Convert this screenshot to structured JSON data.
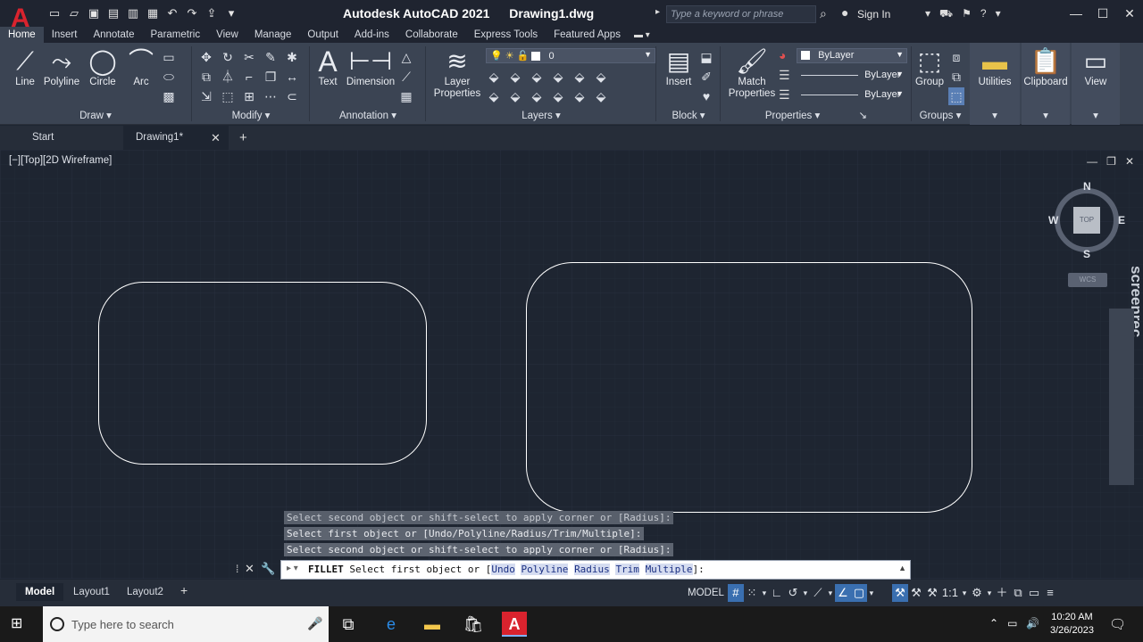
{
  "window": {
    "app_title": "Autodesk AutoCAD 2021",
    "file_title": "Drawing1.dwg",
    "search_placeholder": "Type a keyword or phrase",
    "sign_in": "Sign In"
  },
  "ribbon_tabs": [
    "Home",
    "Insert",
    "Annotate",
    "Parametric",
    "View",
    "Manage",
    "Output",
    "Add-ins",
    "Collaborate",
    "Express Tools",
    "Featured Apps"
  ],
  "draw_panel": {
    "title": "Draw",
    "tools": [
      "Line",
      "Polyline",
      "Circle",
      "Arc"
    ]
  },
  "modify_panel": {
    "title": "Modify"
  },
  "annotation_panel": {
    "title": "Annotation",
    "tools": [
      "Text",
      "Dimension"
    ]
  },
  "layers_panel": {
    "title": "Layers",
    "layer_properties": "Layer Properties",
    "current_layer": "0"
  },
  "block_panel": {
    "title": "Block",
    "insert": "Insert"
  },
  "properties_panel": {
    "title": "Properties",
    "match_properties": "Match Properties",
    "color": "ByLayer",
    "linetype": "ByLayer",
    "lineweight": "ByLayer"
  },
  "groups_panel": {
    "title": "Groups",
    "group": "Group"
  },
  "collapsed_panels": [
    "Utilities",
    "Clipboard",
    "View"
  ],
  "file_tabs": {
    "start": "Start",
    "drawing": "Drawing1*"
  },
  "viewport": {
    "label": "[−][Top][2D Wireframe]",
    "compass": {
      "n": "N",
      "s": "S",
      "e": "E",
      "w": "W",
      "face": "TOP"
    },
    "wcs": "WCS",
    "watermark": "screenrec"
  },
  "command_history": [
    "Select second object or shift-select to apply corner or [Radius]:",
    "Select first object or [Undo/Polyline/Radius/Trim/Multiple]:",
    "Select second object or shift-select to apply corner or [Radius]:"
  ],
  "command_line": {
    "command": "FILLET",
    "prompt": "Select first object or [",
    "options": [
      "Undo",
      "Polyline",
      "Radius",
      "Trim",
      "Multiple"
    ],
    "suffix": "]:"
  },
  "layout_tabs": [
    "Model",
    "Layout1",
    "Layout2"
  ],
  "status": {
    "model": "MODEL",
    "scale": "1:1"
  },
  "taskbar": {
    "search_placeholder": "Type here to search",
    "time": "10:20 AM",
    "date": "3/26/2023"
  },
  "colors": {
    "accent": "#3a6fb0",
    "autocad_red": "#d9232e",
    "viewport_bg": "#1e2531"
  }
}
